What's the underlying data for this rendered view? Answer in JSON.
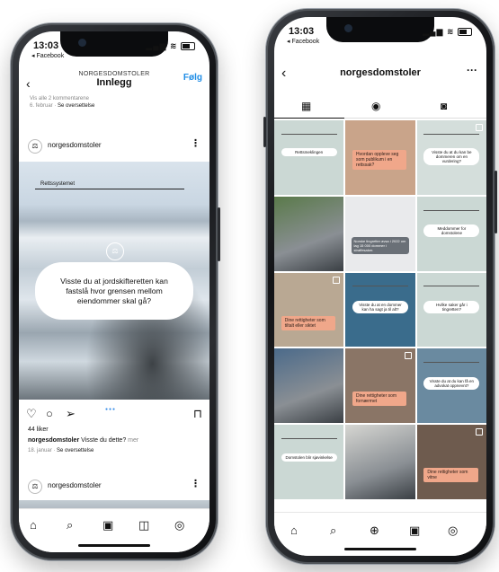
{
  "left_phone": {
    "status": {
      "time": "13:03",
      "back_app": "◂ Facebook"
    },
    "header": {
      "account": "NORGESDOMSTOLER",
      "title": "Innlegg",
      "follow": "Følg"
    },
    "prev_comments": "Vis alle 2 kommentarene",
    "prev_date": "6. februar",
    "prev_translate": "Se oversettelse",
    "post": {
      "account_name": "norgesdomstoler",
      "image_tag": "Rettssystemet",
      "bubble_text": "Visste du at jordskifteretten kan fastslå hvor grensen mellom eiendommer skal gå?",
      "likes": "44 liker",
      "caption_account": "norgesdomstoler",
      "caption_text": "Visste du dette?",
      "caption_more": "mer",
      "date": "18. januar",
      "translate": "Se oversettelse"
    },
    "next_post": {
      "account_name": "norgesdomstoler"
    }
  },
  "right_phone": {
    "status": {
      "time": "13:03",
      "back_app": "◂ Facebook"
    },
    "header": {
      "title": "norgesdomstoler"
    },
    "tiles": [
      {
        "kind": "pill",
        "bg": "#cbd8d4",
        "text": "Rettsmeklingen"
      },
      {
        "kind": "orange",
        "bg": "#c9a48a",
        "text": "Hvordan oppleve seg som publikum i en rettssak?"
      },
      {
        "kind": "pill",
        "bg": "#d4dedb",
        "text": "Visste du at du kan be dommeren om en vurdering?"
      },
      {
        "kind": "photo",
        "bg": "#5a7a4a"
      },
      {
        "kind": "grey",
        "bg": "#e9eaec",
        "text": "Norske tingretter avsa i 2022 om lag 15 000 dommer i straffesaker."
      },
      {
        "kind": "pill",
        "bg": "#cbd8d4",
        "text": "Meddommer for domstolene"
      },
      {
        "kind": "orange",
        "bg": "#b9a893",
        "text": "Dine rettigheter som tiltalt eller siktet"
      },
      {
        "kind": "pill",
        "bg": "#3a6c8c",
        "text": "Visste du at en dommer kan ha sagt ja til alt?"
      },
      {
        "kind": "pill",
        "bg": "#cbd8d4",
        "text": "Hvilke saker går i tingretten?"
      },
      {
        "kind": "photo",
        "bg": "#4b6a8a"
      },
      {
        "kind": "orange",
        "bg": "#8a7566",
        "text": "Dine rettigheter som fornærmet"
      },
      {
        "kind": "pill",
        "bg": "#6a8aa0",
        "text": "Visste du at du kan få en advokat oppnevnt?"
      },
      {
        "kind": "pill",
        "bg": "#cbd8d4",
        "text": "Domstolen blir sjøvinkelse"
      },
      {
        "kind": "photo",
        "bg": "#d6d6d2"
      },
      {
        "kind": "orange",
        "bg": "#6e5b4e",
        "text": "Dine rettigheter som vitne"
      }
    ]
  }
}
